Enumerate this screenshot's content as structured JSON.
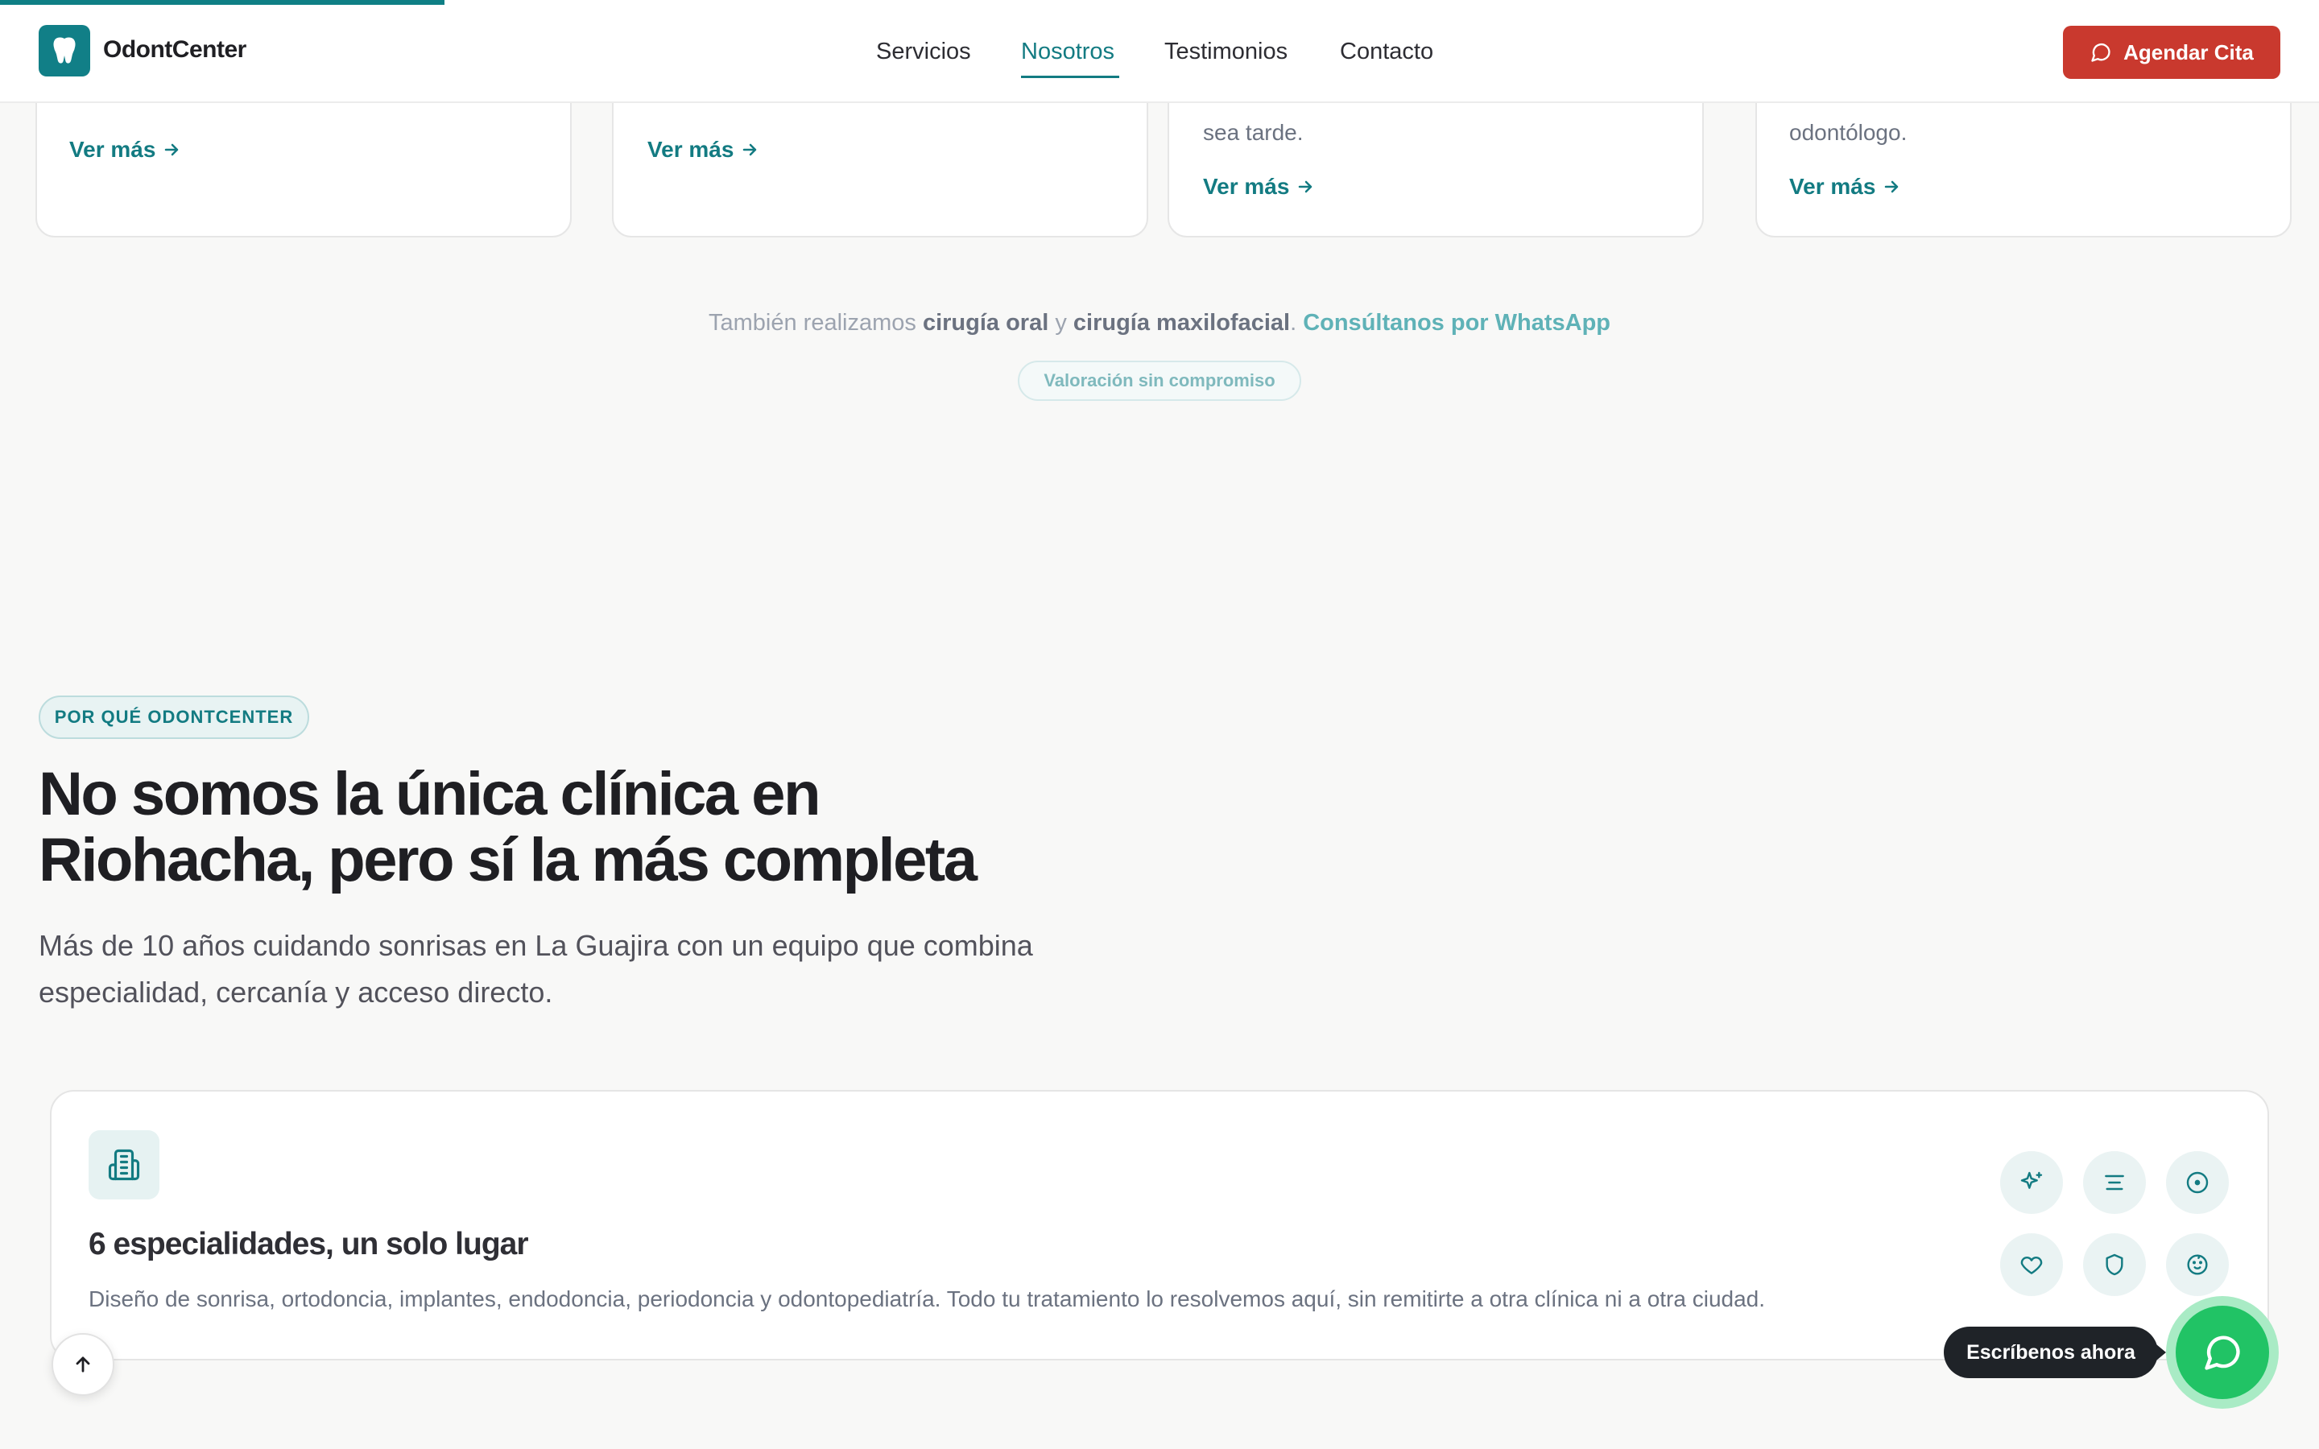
{
  "header": {
    "brand": "OdontCenter",
    "nav": [
      {
        "label": "Servicios",
        "active": false
      },
      {
        "label": "Nosotros",
        "active": true
      },
      {
        "label": "Testimonios",
        "active": false
      },
      {
        "label": "Contacto",
        "active": false
      }
    ],
    "cta_label": "Agendar Cita"
  },
  "service_cards": [
    {
      "text": [],
      "link": "Ver más"
    },
    {
      "text": [],
      "link": "Ver más"
    },
    {
      "text": [
        "sea tarde."
      ],
      "link": "Ver más"
    },
    {
      "text": [
        "odontólogo."
      ],
      "link": "Ver más"
    }
  ],
  "extra_services": {
    "prefix": "También realizamos",
    "service_1": "cirugía oral",
    "connector": "y",
    "service_2": "cirugía maxilofacial",
    "period": ".",
    "whatsapp_link": "Consúltanos por WhatsApp",
    "pill": "Valoración sin compromiso"
  },
  "why": {
    "badge": "POR QUÉ ODONTCENTER",
    "heading_line1": "No somos la única clínica en",
    "heading_line2": "Riohacha, pero sí la más completa",
    "subtitle_line1": "Más de 10 años cuidando sonrisas en La Guajira con un equipo que combina",
    "subtitle_line2": "especialidad, cercanía y acceso directo."
  },
  "feature": {
    "icon": "building-icon",
    "title": "6 especialidades, un solo lugar",
    "description": "Diseño de sonrisa, ortodoncia, implantes, endodoncia, periodoncia y odontopediatría. Todo tu tratamiento lo resolvemos aquí, sin remitirte a otra clínica ni a otra ciudad.",
    "specialty_icons": [
      "sparkles-icon",
      "align-center-icon",
      "circle-dot-icon",
      "heart-icon",
      "shield-icon",
      "baby-icon"
    ]
  },
  "floating": {
    "scroll_top_icon": "arrow-up-icon",
    "tooltip": "Escríbenos ahora",
    "whatsapp_icon": "message-circle-icon"
  },
  "colors": {
    "primary_teal": "#137b82",
    "cta_red": "#c9392e",
    "whatsapp_green": "#21c365",
    "background": "#f8f8f7"
  }
}
